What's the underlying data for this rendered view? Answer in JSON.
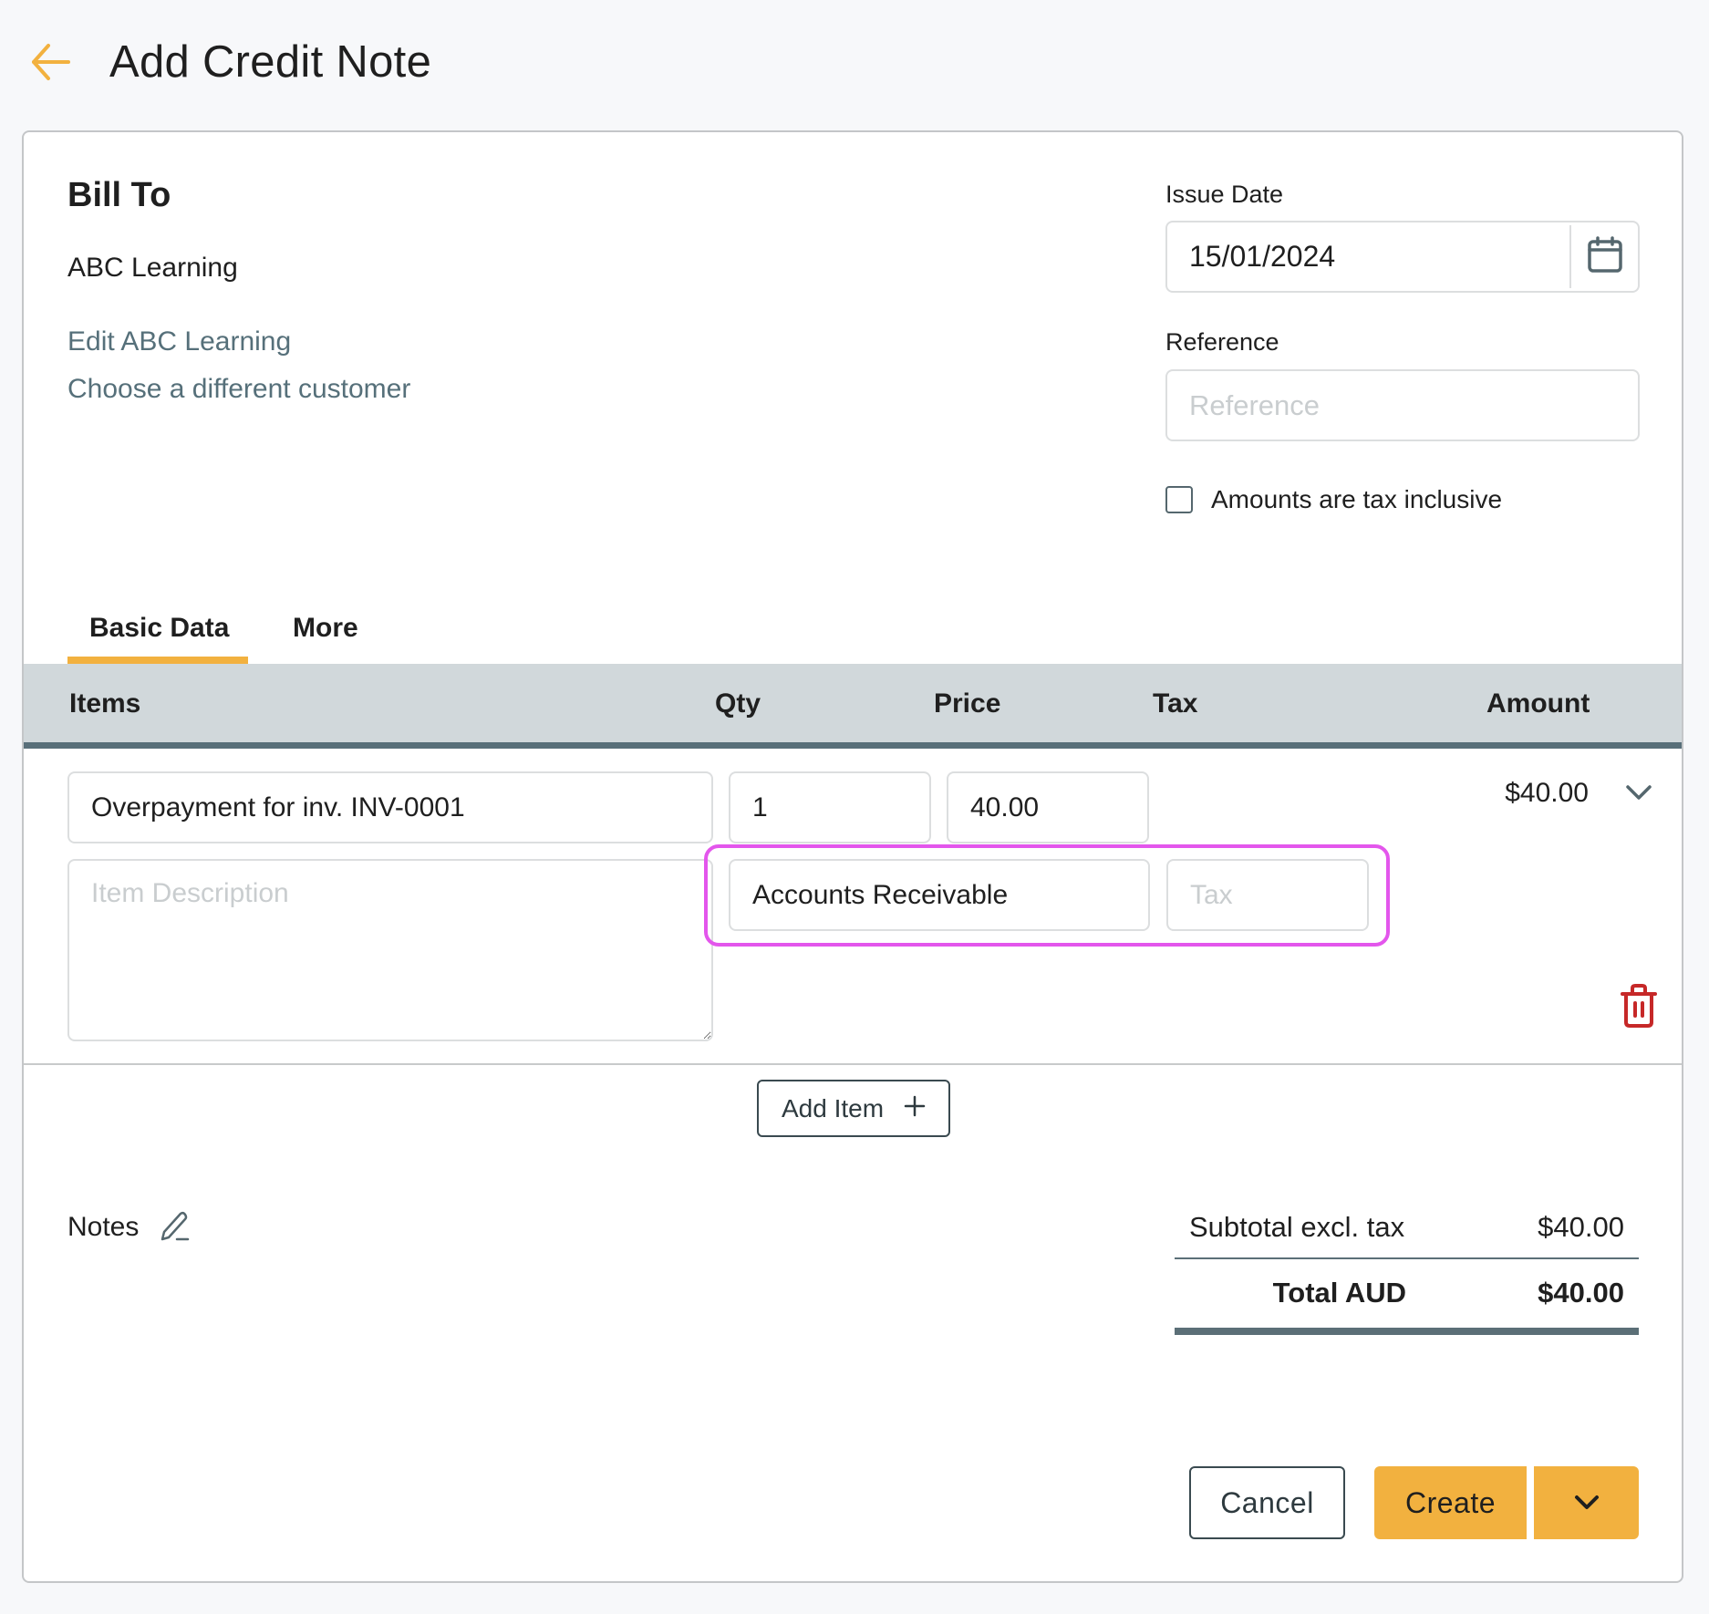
{
  "header": {
    "back_icon": "arrow-left-icon",
    "title": "Add Credit Note"
  },
  "bill_to": {
    "heading": "Bill To",
    "customer_name": "ABC Learning",
    "edit_link": "Edit ABC Learning",
    "choose_link": "Choose a different customer"
  },
  "issue_date": {
    "label": "Issue Date",
    "value": "15/01/2024",
    "icon": "calendar-icon"
  },
  "reference": {
    "label": "Reference",
    "value": "",
    "placeholder": "Reference"
  },
  "tax_inclusive": {
    "label": "Amounts are tax inclusive",
    "checked": false
  },
  "tabs": [
    {
      "label": "Basic Data",
      "active": true
    },
    {
      "label": "More",
      "active": false
    }
  ],
  "table": {
    "columns": [
      "Items",
      "Qty",
      "Price",
      "Tax",
      "Amount"
    ],
    "rows": [
      {
        "item": "Overpayment for inv. INV-0001",
        "qty": "1",
        "price": "40.00",
        "description": "",
        "description_placeholder": "Item Description",
        "account": "Accounts Receivable",
        "tax": "",
        "tax_placeholder": "Tax",
        "amount": "$40.00",
        "expand_icon": "chevron-down-icon",
        "delete_icon": "trash-icon"
      }
    ]
  },
  "add_item": {
    "label": "Add Item",
    "icon": "plus-icon"
  },
  "notes": {
    "label": "Notes",
    "icon": "pencil-icon"
  },
  "totals": {
    "subtotal_label": "Subtotal excl. tax",
    "subtotal_value": "$40.00",
    "total_label": "Total AUD",
    "total_value": "$40.00"
  },
  "actions": {
    "cancel_label": "Cancel",
    "create_label": "Create",
    "create_menu_icon": "chevron-down-icon"
  },
  "colors": {
    "accent": "#f2b13f",
    "highlight": "#e356ec",
    "delete": "#c62828",
    "link": "#56707a",
    "header_band": "#d1d8db",
    "header_rule": "#586f79"
  }
}
